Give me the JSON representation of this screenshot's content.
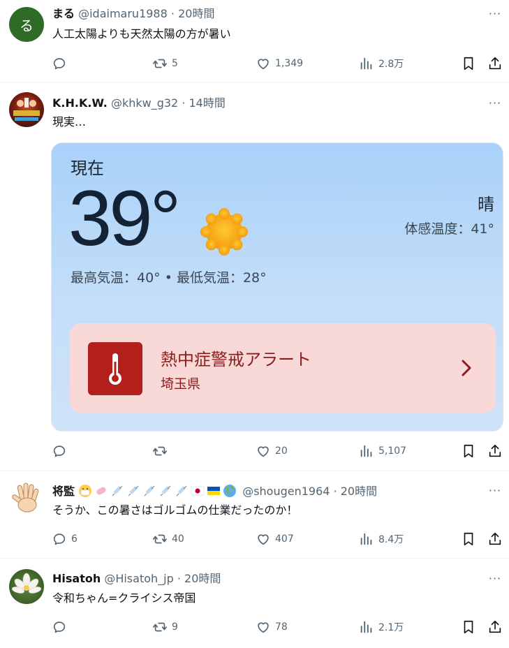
{
  "tweets": [
    {
      "avatar_letter": "る",
      "name": "まる",
      "handle": "@idaimaru1988",
      "time": "20時間",
      "text": "人工太陽よりも天然太陽の方が暑い",
      "replies": "",
      "retweets": "5",
      "likes": "1,349",
      "views": "2.8万"
    },
    {
      "name": "K.H.K.W.",
      "handle": "@khkw_g32",
      "time": "14時間",
      "text": "現実…",
      "replies": "",
      "retweets": "",
      "likes": "20",
      "views": "5,107",
      "weather": {
        "now_label": "現在",
        "temperature": "39°",
        "condition": "晴",
        "feels_like": "体感温度：41°",
        "hi_lo": "最高気温：40° • 最低気温：28°",
        "alert_title": "熱中症警戒アラート",
        "alert_region": "埼玉県"
      }
    },
    {
      "name": "将監",
      "handle": "@shougen1964",
      "time": "20時間",
      "text": "そうか、この暑さはゴルゴムの仕業だったのか！",
      "replies": "6",
      "retweets": "40",
      "likes": "407",
      "views": "8.4万",
      "emojis": [
        "face-mask-emoji",
        "pill-emoji",
        "syringe-emoji",
        "syringe-emoji",
        "syringe-emoji",
        "syringe-emoji",
        "syringe-emoji",
        "japan-flag-emoji",
        "ukraine-flag-emoji",
        "globe-emoji"
      ]
    },
    {
      "name": "Hisatoh",
      "handle": "@Hisatoh_jp",
      "time": "20時間",
      "text": "令和ちゃん=クライシス帝国",
      "replies": "",
      "retweets": "9",
      "likes": "78",
      "views": "2.1万"
    }
  ],
  "sep": "·",
  "more_glyph": "···"
}
